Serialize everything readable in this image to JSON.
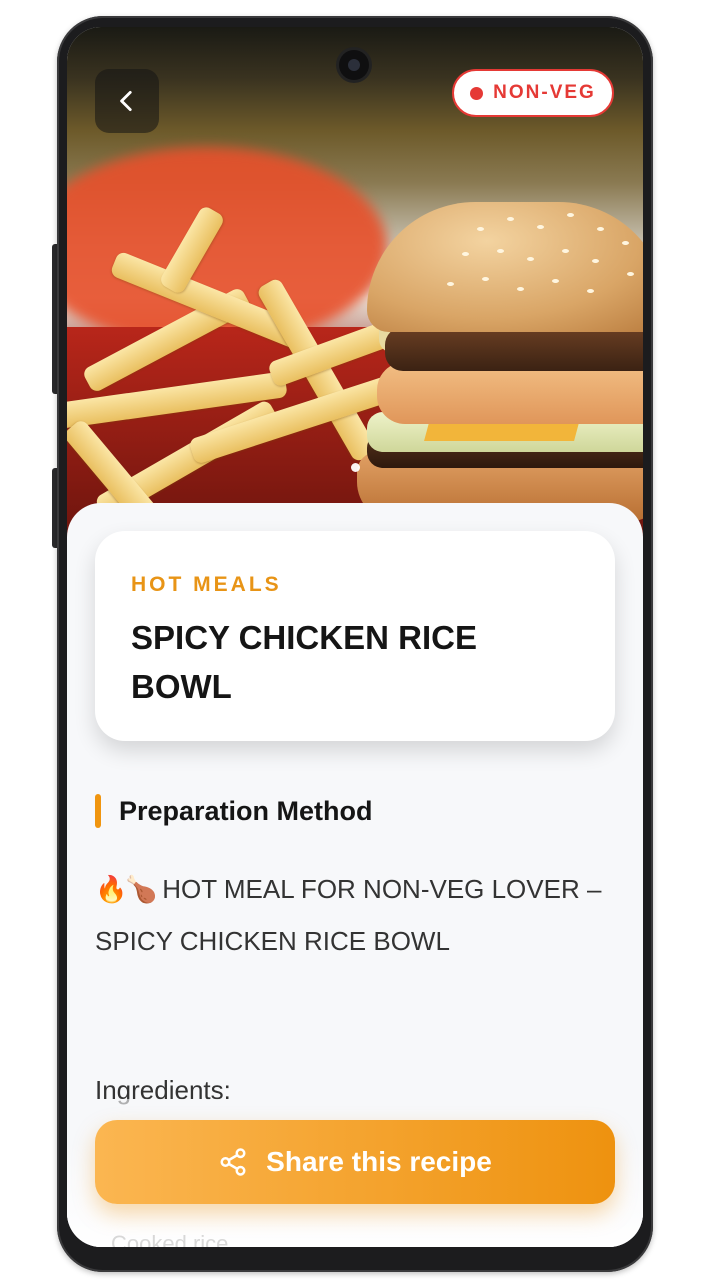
{
  "header": {
    "badge_label": "NON-VEG"
  },
  "recipe": {
    "category": "HOT MEALS",
    "title": "SPICY CHICKEN RICE BOWL"
  },
  "section": {
    "title": "Preparation Method"
  },
  "description": {
    "emoji_1": "🔥",
    "emoji_2": "🍗",
    "text": "HOT MEAL FOR NON-VEG LOVER – SPICY CHICKEN RICE BOWL"
  },
  "ingredients_label": "Ingredients:",
  "faded_item": "Cooked rice",
  "share": {
    "label": "Share this recipe"
  },
  "colors": {
    "accent": "#ee920f",
    "non_veg": "#e53935"
  },
  "icons": {
    "back": "chevron-left-icon",
    "share": "share-icon"
  }
}
